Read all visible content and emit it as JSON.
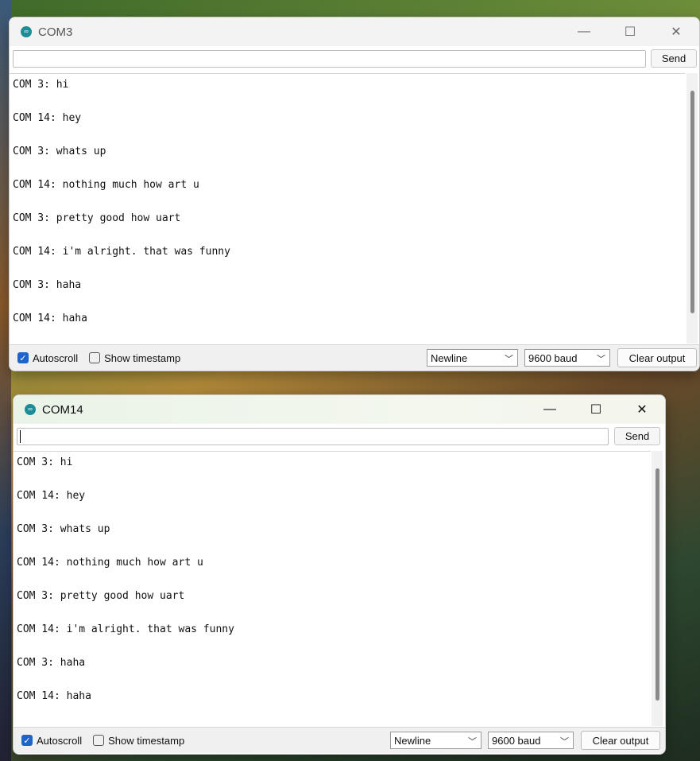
{
  "windows": [
    {
      "title": "COM3",
      "input_value": "",
      "send_label": "Send",
      "lines": [
        "COM 3: hi",
        "COM 14: hey",
        "COM 3: whats up",
        "COM 14: nothing much how art u",
        "COM 3: pretty good how uart",
        "COM 14: i'm alright. that was funny",
        "COM 3: haha",
        "COM 14: haha"
      ],
      "autoscroll_label": "Autoscroll",
      "autoscroll_checked": true,
      "timestamp_label": "Show timestamp",
      "timestamp_checked": false,
      "line_ending": "Newline",
      "baud": "9600 baud",
      "clear_label": "Clear output"
    },
    {
      "title": "COM14",
      "input_value": "",
      "send_label": "Send",
      "lines": [
        "COM 3: hi",
        "COM 14: hey",
        "COM 3: whats up",
        "COM 14: nothing much how art u",
        "COM 3: pretty good how uart",
        "COM 14: i'm alright. that was funny",
        "COM 3: haha",
        "COM 14: haha"
      ],
      "autoscroll_label": "Autoscroll",
      "autoscroll_checked": true,
      "timestamp_label": "Show timestamp",
      "timestamp_checked": false,
      "line_ending": "Newline",
      "baud": "9600 baud",
      "clear_label": "Clear output"
    }
  ],
  "icons": {
    "app": "arduino-icon",
    "minimize": "minimize-icon",
    "maximize": "maximize-icon",
    "close": "close-icon",
    "dropdown": "chevron-down-icon",
    "check": "checkmark-icon"
  },
  "colors": {
    "checkbox_accent": "#1f64c8",
    "app_icon": "#1c8c96"
  }
}
